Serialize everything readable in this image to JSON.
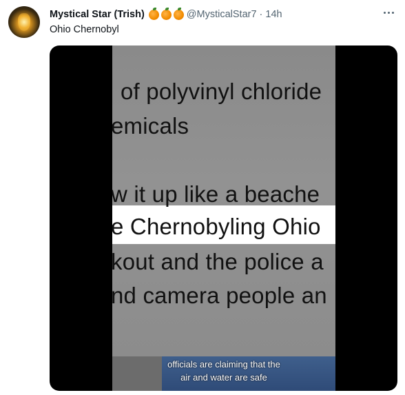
{
  "tweet": {
    "display_name": "Mystical Star (Trish)",
    "emoji_icons": [
      "orange-emoji",
      "orange-emoji",
      "orange-emoji"
    ],
    "handle": "@MysticalStar7",
    "separator": "·",
    "time": "14h",
    "text": "Ohio Chernobyl"
  },
  "video": {
    "lines": [
      "of polyvinyl chloride",
      "emicals",
      "w it up like a beache",
      "e Chernobyling Ohio",
      "kout and the police a",
      "nd camera people an"
    ],
    "caption_line1": "officials are claiming that the",
    "caption_line2": "air and water are safe"
  },
  "colors": {
    "text": "#0f1419",
    "secondary": "#536471",
    "video_background": "#000000",
    "caption_background": "#2f4b78"
  }
}
